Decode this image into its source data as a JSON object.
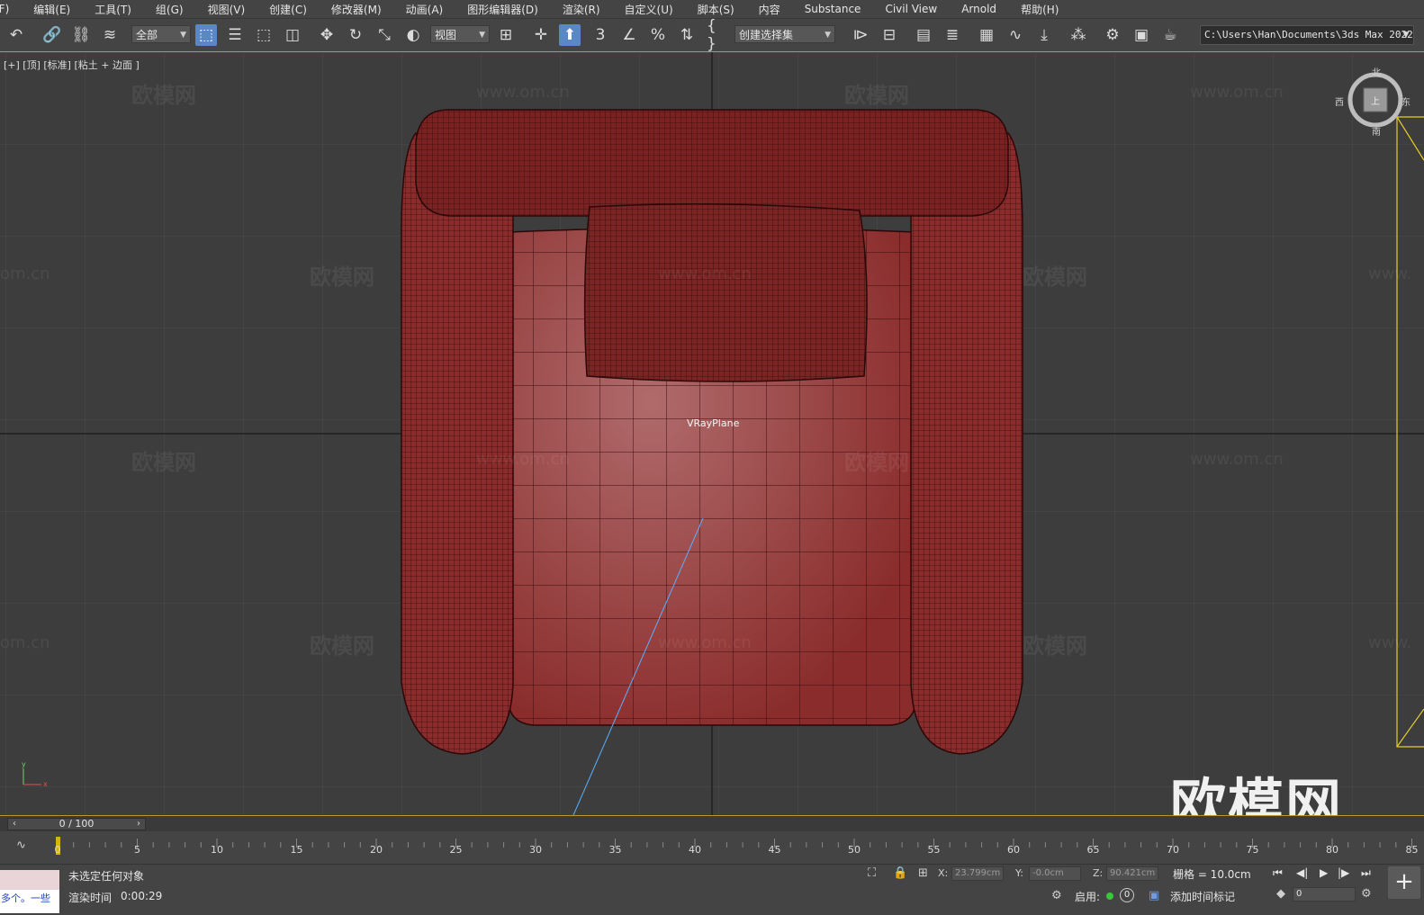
{
  "menu": [
    "(F)",
    "编辑(E)",
    "工具(T)",
    "组(G)",
    "视图(V)",
    "创建(C)",
    "修改器(M)",
    "动画(A)",
    "图形编辑器(D)",
    "渲染(R)",
    "自定义(U)",
    "脚本(S)",
    "内容",
    "Substance",
    "Civil View",
    "Arnold",
    "帮助(H)"
  ],
  "toolbar": {
    "filter_value": "全部",
    "refcoord_value": "视图",
    "selection_set": "创建选择集",
    "snap_number": "3",
    "project_path": "C:\\Users\\Han\\Documents\\3ds Max 2022"
  },
  "viewport": {
    "label": "[+] [顶] [标准] [粘土 + 边面 ]",
    "object_label": "VRayPlane",
    "watermark_text": "欧模网",
    "watermark_url": "www.om.cn",
    "watermark_url_cut": "om.cn",
    "watermark_url_cut_right": "www.",
    "big_watermark": "欧模网",
    "viewcube": {
      "north": "北",
      "west": "西",
      "east": "东",
      "south": "南",
      "face": "上"
    }
  },
  "time_slider": {
    "label": "0 / 100"
  },
  "trackbar": {
    "ticks": [
      "0",
      "5",
      "10",
      "15",
      "20",
      "25",
      "30",
      "35",
      "40",
      "45",
      "50",
      "55",
      "60",
      "65",
      "70",
      "75",
      "80",
      "85"
    ]
  },
  "status": {
    "listener_text": "多个。一些",
    "selection_message": "未选定任何对象",
    "render_time_label": "渲染时间",
    "render_time_value": "0:00:29",
    "x_label": "X:",
    "x_value": "23.799cm",
    "y_label": "Y:",
    "y_value": "-0.0cm",
    "z_label": "Z:",
    "z_value": "90.421cm",
    "grid_label": "栅格 = 10.0cm",
    "enable_label": "启用:",
    "enable_value": "0",
    "add_time_tag": "添加时间标记",
    "frame_value": "0"
  },
  "colors": {
    "sofa": "#8a2c2c",
    "wire": "#3a0c0c",
    "accent": "#5a87c6",
    "timeline": "#b49a2c"
  }
}
